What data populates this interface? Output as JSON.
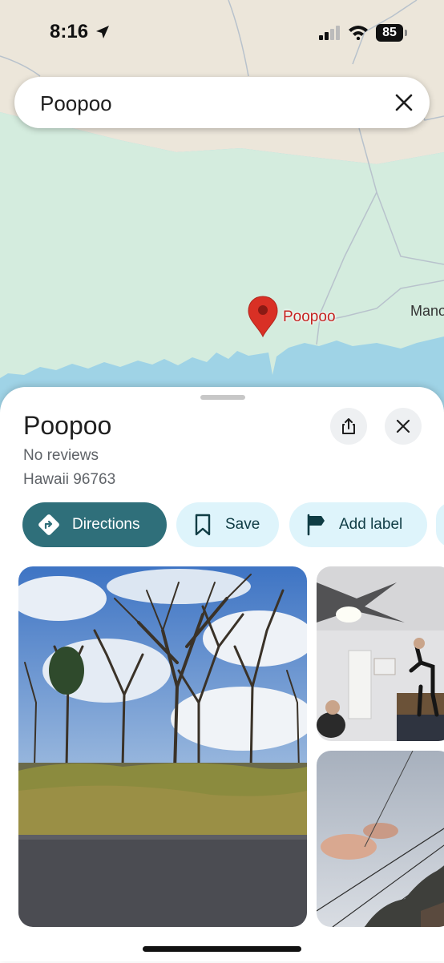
{
  "status_bar": {
    "time": "8:16",
    "battery": "85"
  },
  "search": {
    "query": "Poopoo"
  },
  "map": {
    "pin_label": "Poopoo",
    "town_label": "Mano"
  },
  "place": {
    "title": "Poopoo",
    "reviews": "No reviews",
    "address": "Hawaii 96763"
  },
  "actions": {
    "directions": "Directions",
    "save": "Save",
    "add_label": "Add label"
  },
  "colors": {
    "accent": "#2f6f7a",
    "chip_bg": "#def4fb",
    "pin": "#d93025",
    "water": "#9fd3e6",
    "land": "#d4ecde"
  },
  "icons": [
    "navigation-arrow-icon",
    "signal-icon",
    "wifi-icon",
    "battery-icon",
    "close-icon",
    "map-pin-icon",
    "share-icon",
    "directions-icon",
    "bookmark-icon",
    "flag-icon"
  ]
}
